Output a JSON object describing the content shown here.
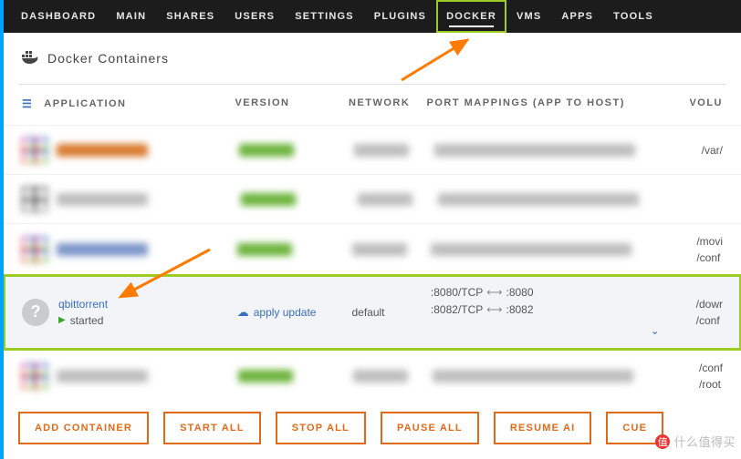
{
  "nav": {
    "items": [
      "DASHBOARD",
      "MAIN",
      "SHARES",
      "USERS",
      "SETTINGS",
      "PLUGINS",
      "DOCKER",
      "VMS",
      "APPS",
      "TOOLS"
    ],
    "active": "DOCKER"
  },
  "section": {
    "title": "Docker Containers"
  },
  "columns": {
    "app": "APPLICATION",
    "ver": "VERSION",
    "net": "NETWORK",
    "port": "PORT MAPPINGS (APP TO HOST)",
    "vol": "VOLU"
  },
  "rows": {
    "blurred": [
      {
        "vol": "/var/"
      },
      {
        "vol": ""
      },
      {
        "vol": "/movi\n/conf"
      },
      {
        "vol": "/conf\n/root"
      }
    ],
    "qb": {
      "name": "qbittorrent",
      "status": "started",
      "version_action": "apply update",
      "network": "default",
      "ports": [
        {
          "app": ":8080/TCP",
          "host": ":8080"
        },
        {
          "app": ":8082/TCP",
          "host": ":8082"
        }
      ],
      "vol": "/dowr\n/conf"
    }
  },
  "footer": {
    "add": "ADD CONTAINER",
    "start": "START ALL",
    "stop": "STOP ALL",
    "pause": "PAUSE ALL",
    "resume": "RESUME AI",
    "cue": "CUE"
  },
  "watermark": "什么值得买"
}
